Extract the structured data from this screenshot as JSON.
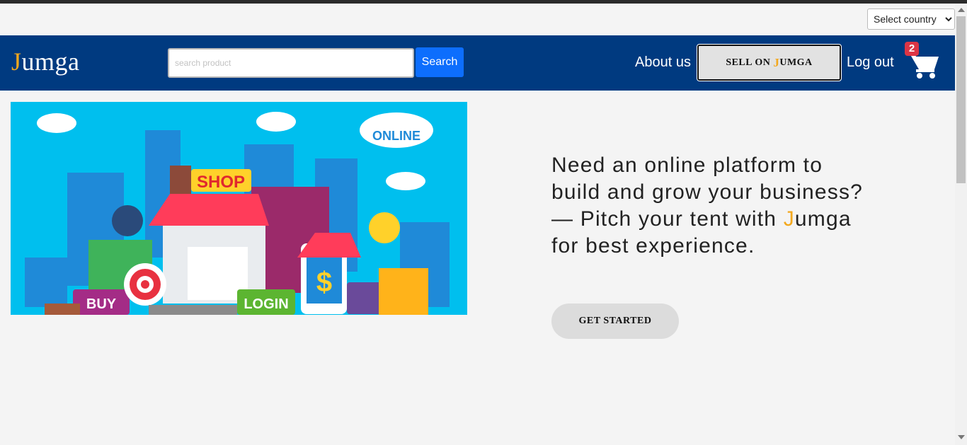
{
  "country_select": {
    "selected": "Select country"
  },
  "navbar": {
    "brand_initial": "J",
    "brand_rest": "umga",
    "search_placeholder": "search product",
    "search_button": "Search",
    "about_link": "About us",
    "sell_button": {
      "prefix": "SELL ON ",
      "initial": "J",
      "rest": "UMGA"
    },
    "logout_link": "Log out",
    "cart_count": "2"
  },
  "hero": {
    "image_labels": {
      "online": "ONLINE",
      "shop": "SHOP",
      "buy": "BUY",
      "login": "LOGIN",
      "dollar": "$"
    },
    "text_before": "Need an online platform to build and grow your business? — Pitch your tent with ",
    "text_brand_initial": "J",
    "text_brand_rest": "umga",
    "text_after": " for best experience.",
    "cta_label": "GET STARTED"
  },
  "colors": {
    "navbar": "#003a80",
    "accent": "#f3a81d",
    "search_button": "#0d6efd",
    "badge": "#dc3545",
    "hero_bg": "#00bfee"
  },
  "icons": [
    "cart-icon",
    "chevron-down-icon"
  ]
}
